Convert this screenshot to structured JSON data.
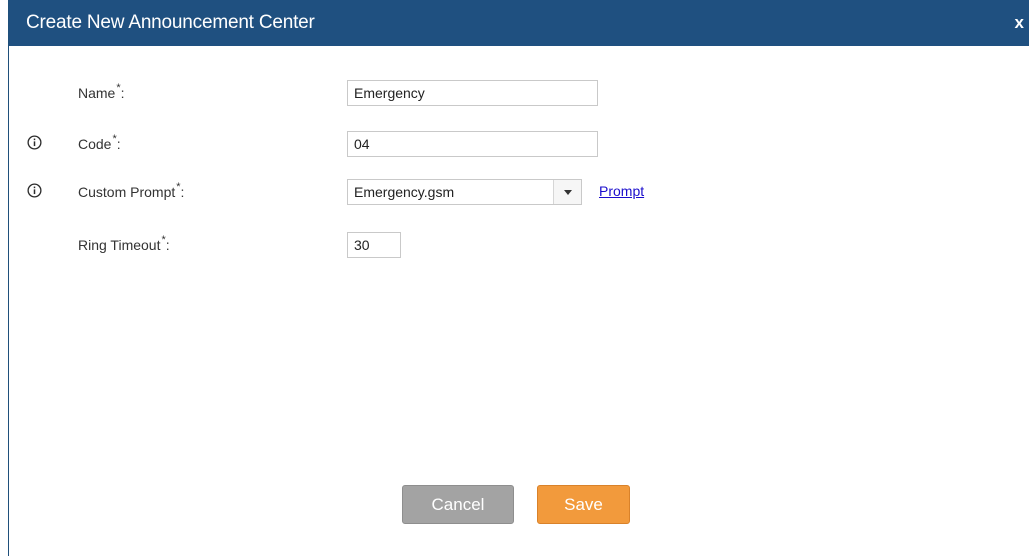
{
  "dialog": {
    "title": "Create New Announcement Center",
    "close_label": "x"
  },
  "fields": {
    "name": {
      "label": "Name",
      "required": "*",
      "colon": ":",
      "value": "Emergency"
    },
    "code": {
      "label": "Code",
      "required": "*",
      "colon": ":",
      "value": "04"
    },
    "custom_prompt": {
      "label": "Custom Prompt",
      "required": "*",
      "colon": ":",
      "value": "Emergency.gsm",
      "link": "Prompt"
    },
    "ring_timeout": {
      "label": "Ring Timeout",
      "required": "*",
      "colon": ":",
      "value": "30"
    }
  },
  "buttons": {
    "cancel": "Cancel",
    "save": "Save"
  },
  "colors": {
    "titlebar": "#1f5080",
    "save": "#f29a3c",
    "cancel": "#a3a3a3",
    "link": "#1a0dcc"
  },
  "icons": [
    "info-icon",
    "chevron-down-icon",
    "close-icon"
  ]
}
